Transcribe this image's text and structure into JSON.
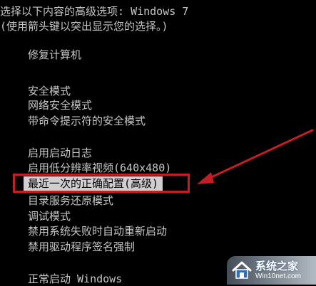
{
  "header": {
    "line1": "选择以下内容的高级选项: Windows 7",
    "line2": "(使用箭头键以突出显示您的选择。)"
  },
  "menu": {
    "items": [
      {
        "label": "修复计算机",
        "selected": false
      },
      {
        "label": "安全模式",
        "selected": false
      },
      {
        "label": "网络安全模式",
        "selected": false
      },
      {
        "label": "带命令提示符的安全模式",
        "selected": false
      },
      {
        "label": "启用启动日志",
        "selected": false
      },
      {
        "label": "启用低分辨率视频(640x480)",
        "selected": false
      },
      {
        "label": "最近一次的正确配置(高级)",
        "selected": true
      },
      {
        "label": "目录服务还原模式",
        "selected": false
      },
      {
        "label": "调试模式",
        "selected": false
      },
      {
        "label": "禁用系统失败时自动重新启动",
        "selected": false
      },
      {
        "label": "禁用驱动程序签名强制",
        "selected": false
      },
      {
        "label": "正常启动 Windows",
        "selected": false
      }
    ]
  },
  "annotation": {
    "box_color": "#c41e22",
    "arrow_color": "#c41e22"
  },
  "watermark": {
    "title": "系统之家",
    "url": "Win10net.com",
    "icon": "house-logo-icon"
  }
}
